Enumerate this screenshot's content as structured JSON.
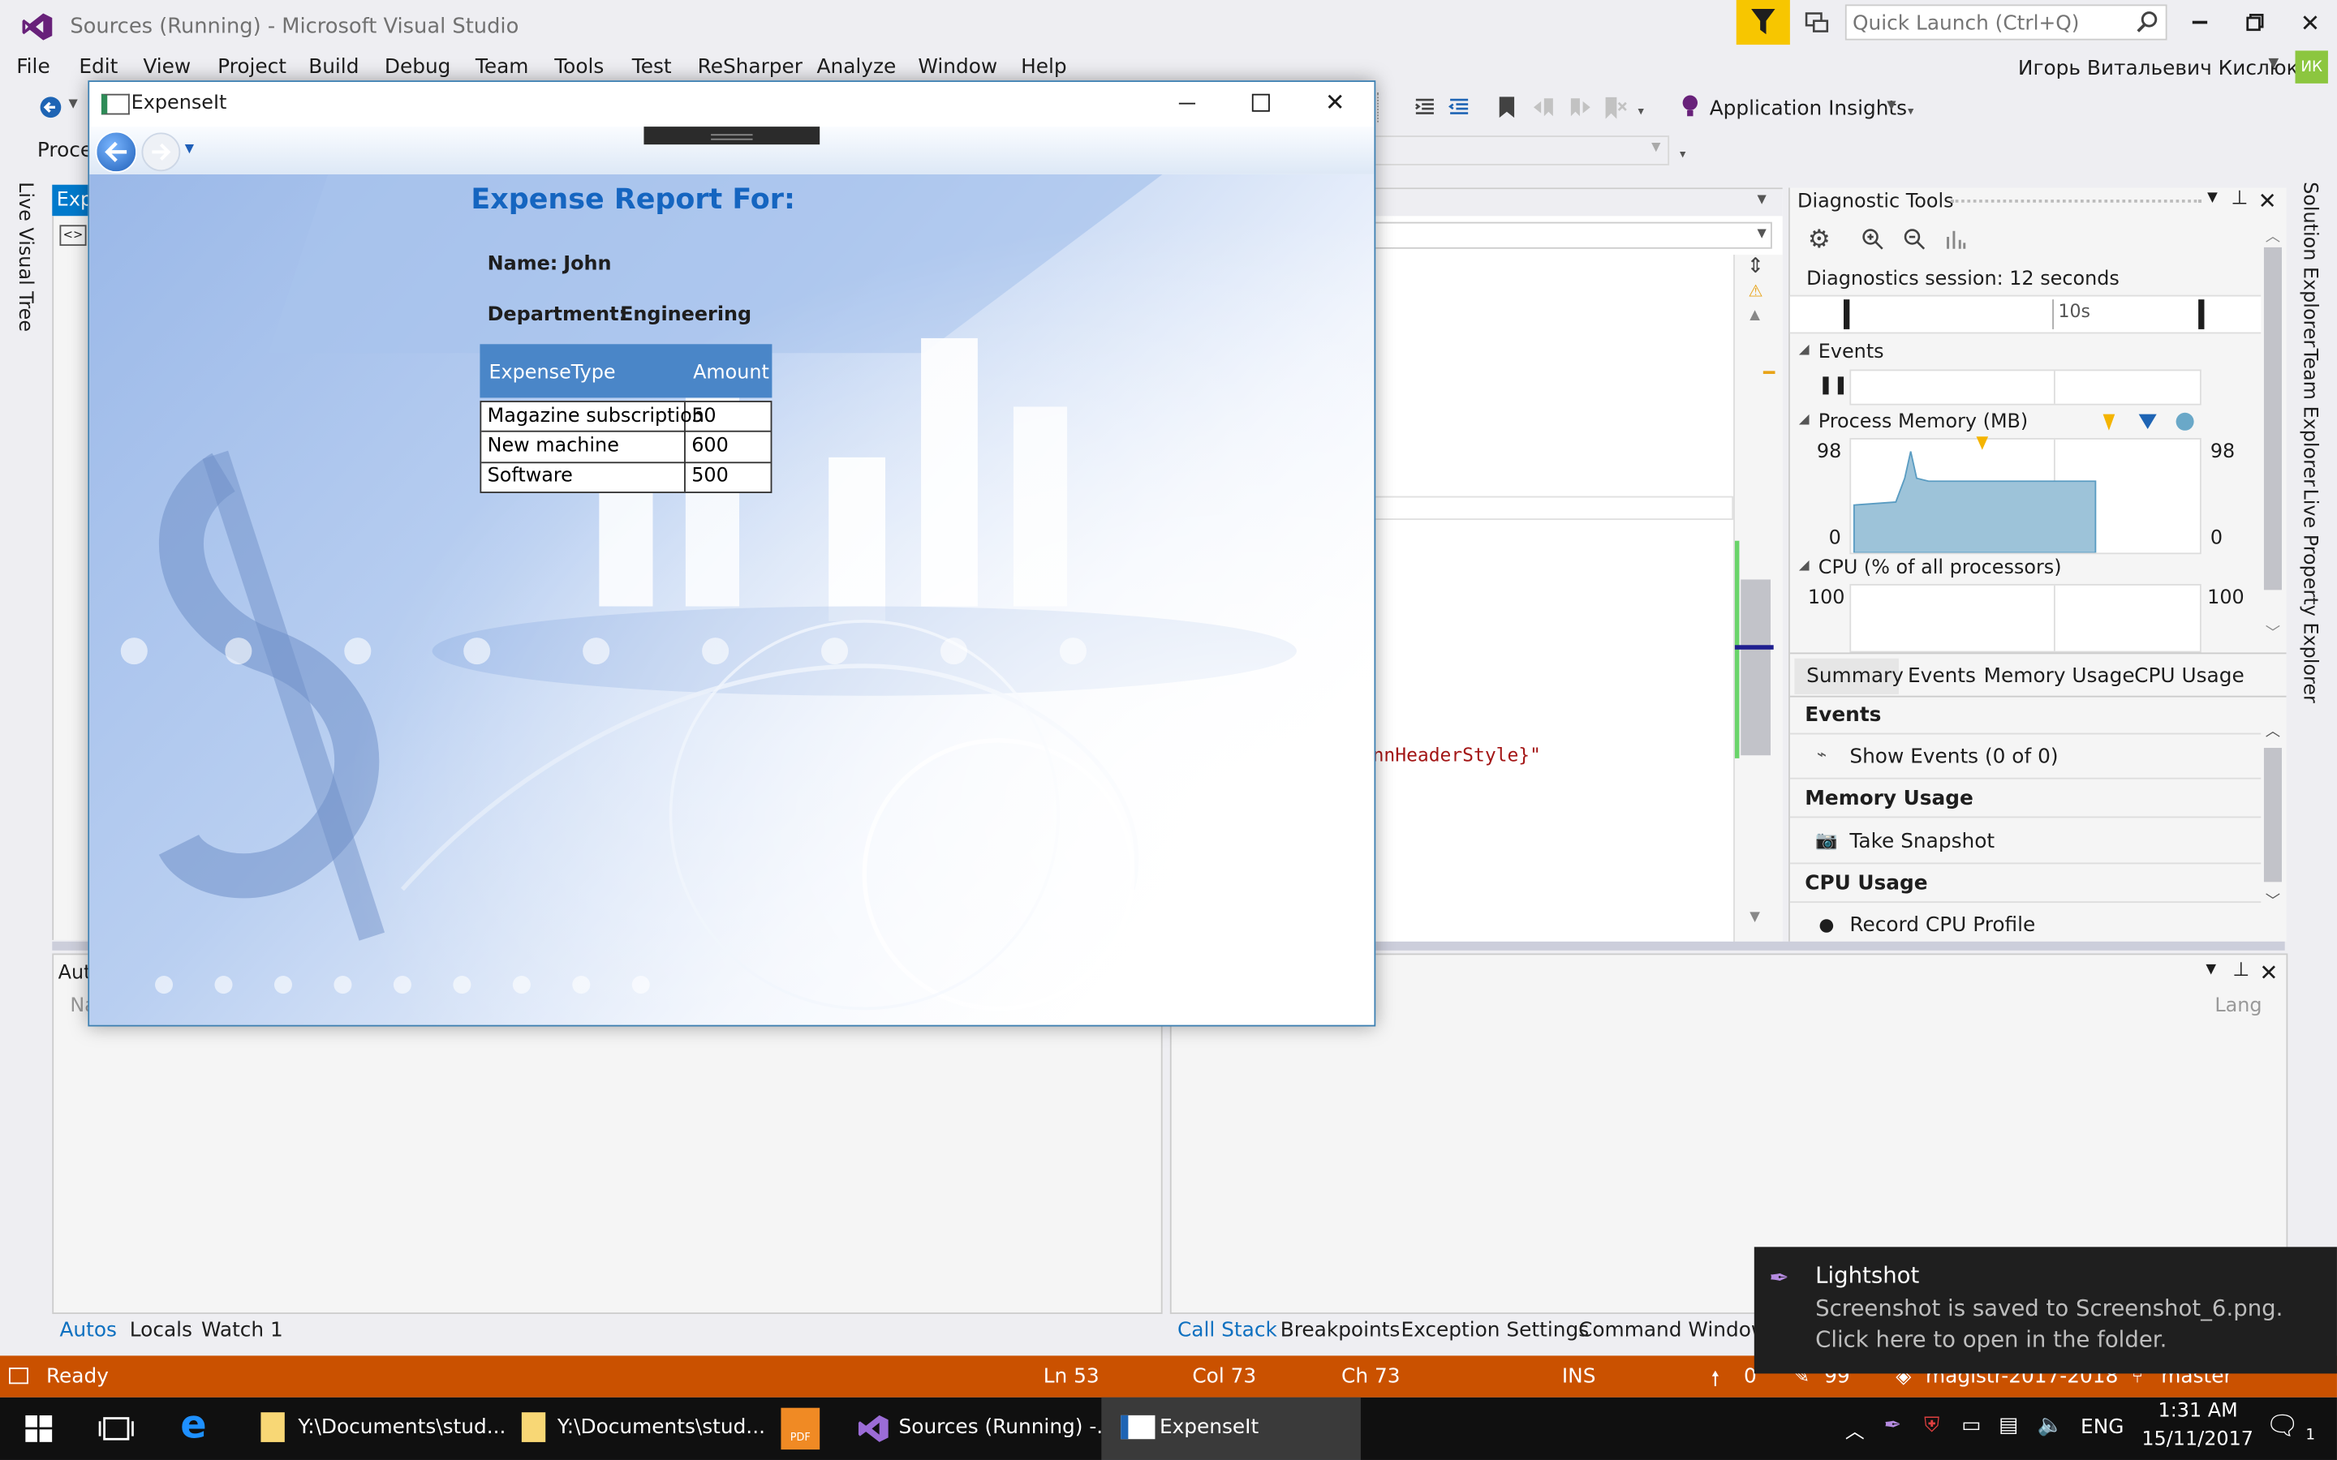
{
  "vs": {
    "title": "Sources (Running) - Microsoft Visual Studio",
    "quick_launch_placeholder": "Quick Launch (Ctrl+Q)",
    "user_name": "Игорь Витальевич Кислюк",
    "user_initials": "ИК",
    "menu": [
      "File",
      "Edit",
      "View",
      "Project",
      "Build",
      "Debug",
      "Team",
      "Tools",
      "Test",
      "ReSharper",
      "Analyze",
      "Window",
      "Help"
    ],
    "app_insights": "Application Insights",
    "process_label": "Proces",
    "side_tab_left": "Live Visual Tree",
    "side_tabs_right": [
      "Solution Explorer",
      "Team Explorer",
      "Live Property Explorer"
    ],
    "doc_tab_fragment": "Exp",
    "code_fragment": "nnHeaderStyle}\"",
    "autos_header_fragment": "Aut",
    "name_col_fragment": "Na",
    "lang_col_fragment": "Lang",
    "bottom_left_tabs": [
      "Autos",
      "Locals",
      "Watch 1"
    ],
    "bottom_right_tabs": [
      "Call Stack",
      "Breakpoints",
      "Exception Settings",
      "Command Window"
    ]
  },
  "expense_window": {
    "title": "ExpenseIt",
    "heading": "Expense Report For:",
    "name_label": "Name:",
    "name_value": "John",
    "department_label": "Department:",
    "department_value": "Engineering",
    "table": {
      "headers": [
        "ExpenseType",
        "Amount"
      ],
      "rows": [
        [
          "Magazine subscription",
          "50"
        ],
        [
          "New machine",
          "600"
        ],
        [
          "Software",
          "500"
        ]
      ]
    }
  },
  "diagnostics": {
    "title": "Diagnostic Tools",
    "session": "Diagnostics session: 12 seconds",
    "timeline_tick": "10s",
    "events_header": "Events",
    "memory_header": "Process Memory (MB)",
    "memory_max": "98",
    "memory_min": "0",
    "cpu_header": "CPU (% of all processors)",
    "cpu_max": "100",
    "tabs": [
      "Summary",
      "Events",
      "Memory Usage",
      "CPU Usage"
    ],
    "summary_events": "Events",
    "show_events": "Show Events (0 of 0)",
    "memory_usage": "Memory Usage",
    "take_snapshot": "Take Snapshot",
    "cpu_usage": "CPU Usage",
    "record_cpu": "Record CPU Profile"
  },
  "statusbar": {
    "ready": "Ready",
    "ln": "Ln 53",
    "col": "Col 73",
    "ch": "Ch 73",
    "ins": "INS",
    "push_count": "0",
    "pending": "99",
    "repo": "magistr-2017-2018",
    "branch": "master"
  },
  "toast": {
    "app": "Lightshot",
    "line1": "Screenshot is saved to Screenshot_6.png.",
    "line2": "Click here to open in the folder."
  },
  "taskbar": {
    "items": [
      "Y:\\Documents\\stud...",
      "Y:\\Documents\\stud...",
      "Sources (Running) -...",
      "ExpenseIt"
    ],
    "lang": "ENG",
    "time": "1:31 AM",
    "date": "15/11/2017",
    "notif_count": "1"
  },
  "colors": {
    "vs_accent": "#68217a",
    "status_debug": "#ca5100",
    "heading_blue": "#1565c0",
    "table_header": "#4a86c8"
  }
}
